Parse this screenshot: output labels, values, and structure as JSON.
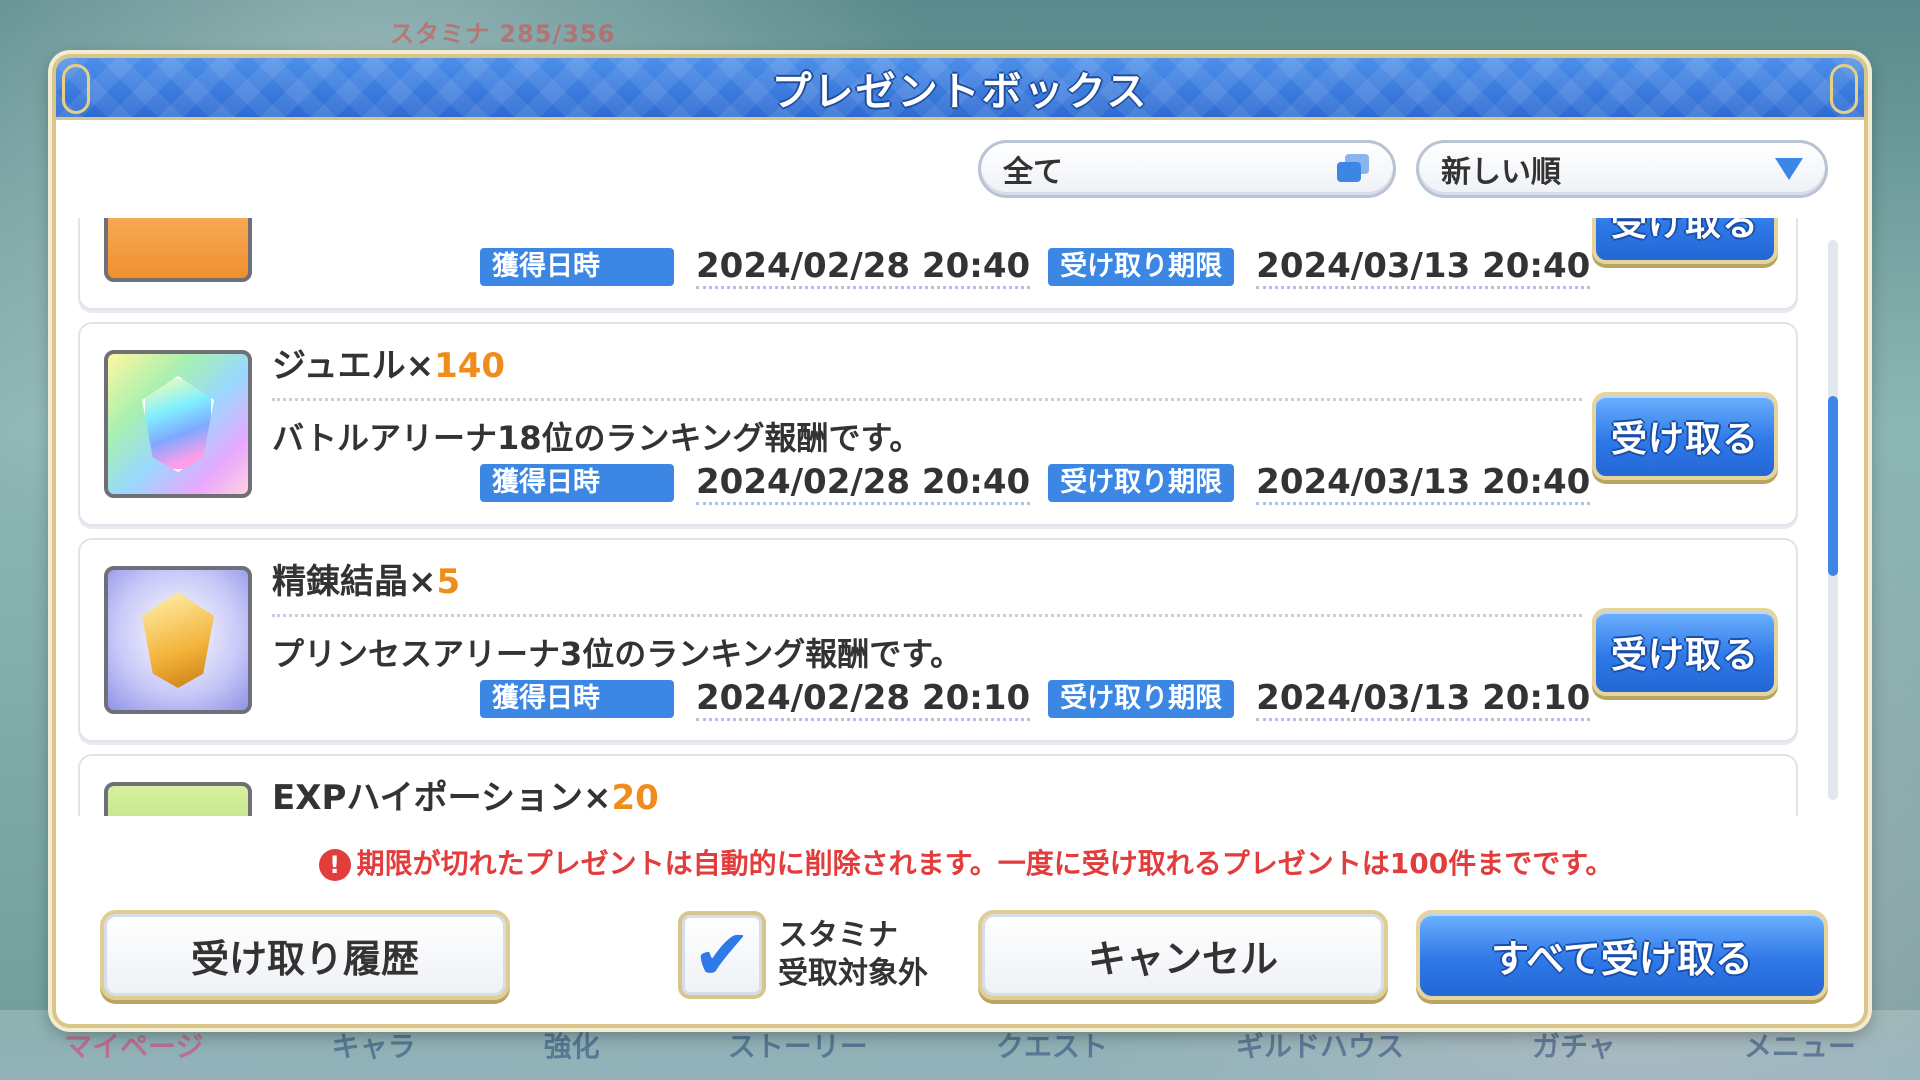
{
  "background": {
    "stamina_text": "スタミナ 285/356",
    "nav": [
      "マイページ",
      "キャラ",
      "強化",
      "ストーリー",
      "クエスト",
      "ギルドハウス",
      "ガチャ",
      "メニュー"
    ]
  },
  "dialog": {
    "title": "プレゼントボックス",
    "filter": {
      "category_label": "全て",
      "sort_label": "新しい順",
      "category_icon": "filter-icon",
      "sort_icon": "triangle-down-icon"
    },
    "labels": {
      "acquired": "獲得日時",
      "deadline": "受け取り期限",
      "receive": "受け取る"
    },
    "items": [
      {
        "name": "",
        "qty": "",
        "desc": "",
        "icon": "book-icon",
        "acquired": "2024/02/28 20:40",
        "deadline": "2024/03/13 20:40"
      },
      {
        "name": "ジュエル×",
        "qty": "140",
        "desc": "バトルアリーナ18位のランキング報酬です。",
        "icon": "jewel-icon",
        "acquired": "2024/02/28 20:40",
        "deadline": "2024/03/13 20:40"
      },
      {
        "name": "精錬結晶×",
        "qty": "5",
        "desc": "プリンセスアリーナ3位のランキング報酬です。",
        "icon": "refine-crystal-icon",
        "acquired": "2024/02/28 20:10",
        "deadline": "2024/03/13 20:10"
      },
      {
        "name": "EXPハイポーション×",
        "qty": "20",
        "desc": "",
        "icon": "exp-potion-icon",
        "acquired": "",
        "deadline": ""
      }
    ],
    "notice": "期限が切れたプレゼントは自動的に削除されます。一度に受け取れるプレゼントは100件までです。",
    "notice_icon": "!",
    "buttons": {
      "history": "受け取り履歴",
      "stamina_line1": "スタミナ",
      "stamina_line2": "受取対象外",
      "stamina_checked": true,
      "cancel": "キャンセル",
      "receive_all": "すべて受け取る"
    },
    "colors": {
      "accent_blue": "#2f79e8",
      "quantity_orange": "#f08c1c",
      "notice_red": "#e23c3c",
      "gold_border": "#d8c58a"
    }
  }
}
